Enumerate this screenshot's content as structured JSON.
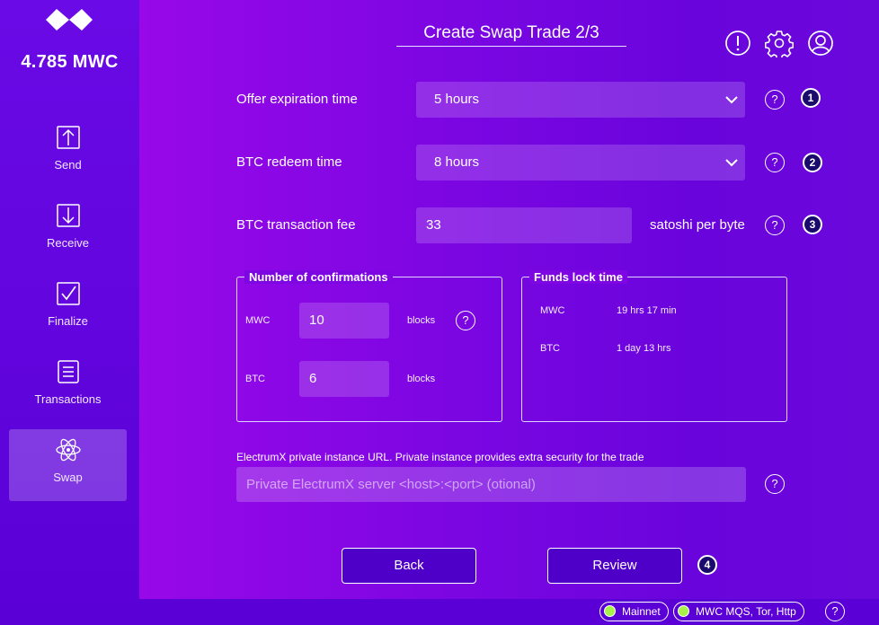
{
  "sidebar": {
    "balance": "4.785 MWC",
    "items": [
      {
        "label": "Send",
        "icon": "send-icon"
      },
      {
        "label": "Receive",
        "icon": "receive-icon"
      },
      {
        "label": "Finalize",
        "icon": "finalize-icon"
      },
      {
        "label": "Transactions",
        "icon": "transactions-icon"
      },
      {
        "label": "Swap",
        "icon": "swap-icon",
        "active": true
      }
    ]
  },
  "header": {
    "title": "Create Swap Trade 2/3",
    "icons": [
      "notification-icon",
      "settings-icon",
      "account-icon"
    ]
  },
  "form": {
    "offer_expiration": {
      "label": "Offer expiration time",
      "value": "5 hours",
      "step": "1"
    },
    "btc_redeem": {
      "label": "BTC redeem time",
      "value": "8 hours",
      "step": "2"
    },
    "btc_fee": {
      "label": "BTC transaction fee",
      "value": "33",
      "unit": "satoshi per byte",
      "step": "3"
    },
    "help_glyph": "?"
  },
  "confirmations": {
    "title": "Number of confirmations",
    "mwc_label": "MWC",
    "mwc_value": "10",
    "btc_label": "BTC",
    "btc_value": "6",
    "unit": "blocks"
  },
  "lock_time": {
    "title": "Funds lock time",
    "mwc_label": "MWC",
    "mwc_value": "19 hrs 17 min",
    "btc_label": "BTC",
    "btc_value": "1 day 13 hrs"
  },
  "electrum": {
    "label": "ElectrumX private instance URL. Private instance provides extra security for the trade",
    "placeholder": "Private ElectrumX server <host>:<port> (otional)",
    "value": ""
  },
  "buttons": {
    "back": "Back",
    "review": "Review",
    "step": "4"
  },
  "statusbar": {
    "network": "Mainnet",
    "connection": "MWC MQS, Tor, Http",
    "status_color": "#a8f04a"
  },
  "colors": {
    "accent": "#7a06e2",
    "sidebar": "#5a00d6"
  }
}
